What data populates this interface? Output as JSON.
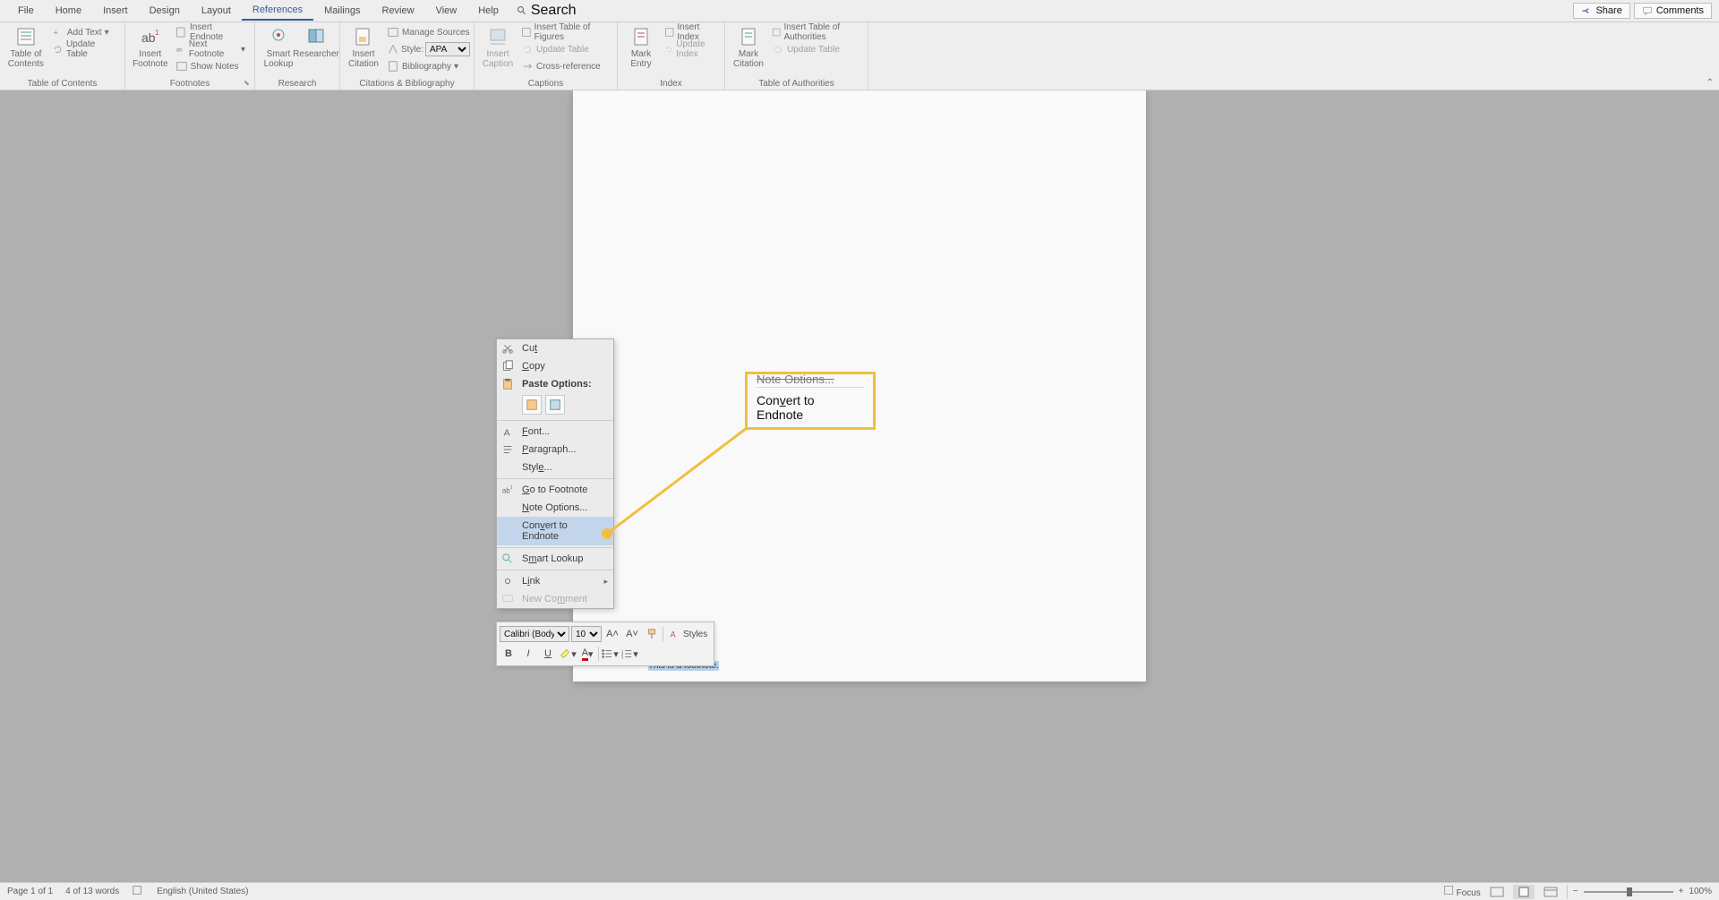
{
  "tabs": {
    "file": "File",
    "home": "Home",
    "insert": "Insert",
    "design": "Design",
    "layout": "Layout",
    "references": "References",
    "mailings": "Mailings",
    "review": "Review",
    "view": "View",
    "help": "Help",
    "search": "Search"
  },
  "share": "Share",
  "comments": "Comments",
  "ribbon": {
    "toc": {
      "label": "Table of Contents",
      "btn": "Table of\nContents",
      "add_text": "Add Text",
      "update_table": "Update Table"
    },
    "footnotes": {
      "label": "Footnotes",
      "insert_footnote": "Insert\nFootnote",
      "insert_endnote": "Insert Endnote",
      "next_footnote": "Next Footnote",
      "show_notes": "Show Notes"
    },
    "research": {
      "label": "Research",
      "smart_lookup": "Smart\nLookup",
      "researcher": "Researcher"
    },
    "citations": {
      "label": "Citations & Bibliography",
      "insert_citation": "Insert\nCitation",
      "manage_sources": "Manage Sources",
      "style_label": "Style:",
      "style_value": "APA",
      "bibliography": "Bibliography"
    },
    "captions": {
      "label": "Captions",
      "insert_caption": "Insert\nCaption",
      "insert_tof": "Insert Table of Figures",
      "update_table": "Update Table",
      "cross_ref": "Cross-reference"
    },
    "index": {
      "label": "Index",
      "mark_entry": "Mark\nEntry",
      "insert_index": "Insert Index",
      "update_index": "Update Index"
    },
    "toa": {
      "label": "Table of Authorities",
      "mark_citation": "Mark\nCitation",
      "insert_toa": "Insert Table of Authorities",
      "update_table": "Update Table"
    }
  },
  "context_menu": {
    "cut": "Cut",
    "copy": "Copy",
    "paste_options": "Paste Options:",
    "font": "Font...",
    "paragraph": "Paragraph...",
    "style": "Style...",
    "go_to_footnote": "Go to Footnote",
    "note_options": "Note Options...",
    "convert_to_endnote": "Convert to Endnote",
    "smart_lookup": "Smart Lookup",
    "link": "Link",
    "new_comment": "New Comment"
  },
  "callout": {
    "note_options": "Note Options...",
    "convert": "Convert to Endnote"
  },
  "footnote": {
    "ref": "1",
    "text": "This is a footnote."
  },
  "mini_toolbar": {
    "font": "Calibri (Body)",
    "size": "10",
    "styles": "Styles"
  },
  "status": {
    "page": "Page 1 of 1",
    "words": "4 of 13 words",
    "language": "English (United States)",
    "focus": "Focus",
    "zoom": "100%"
  }
}
